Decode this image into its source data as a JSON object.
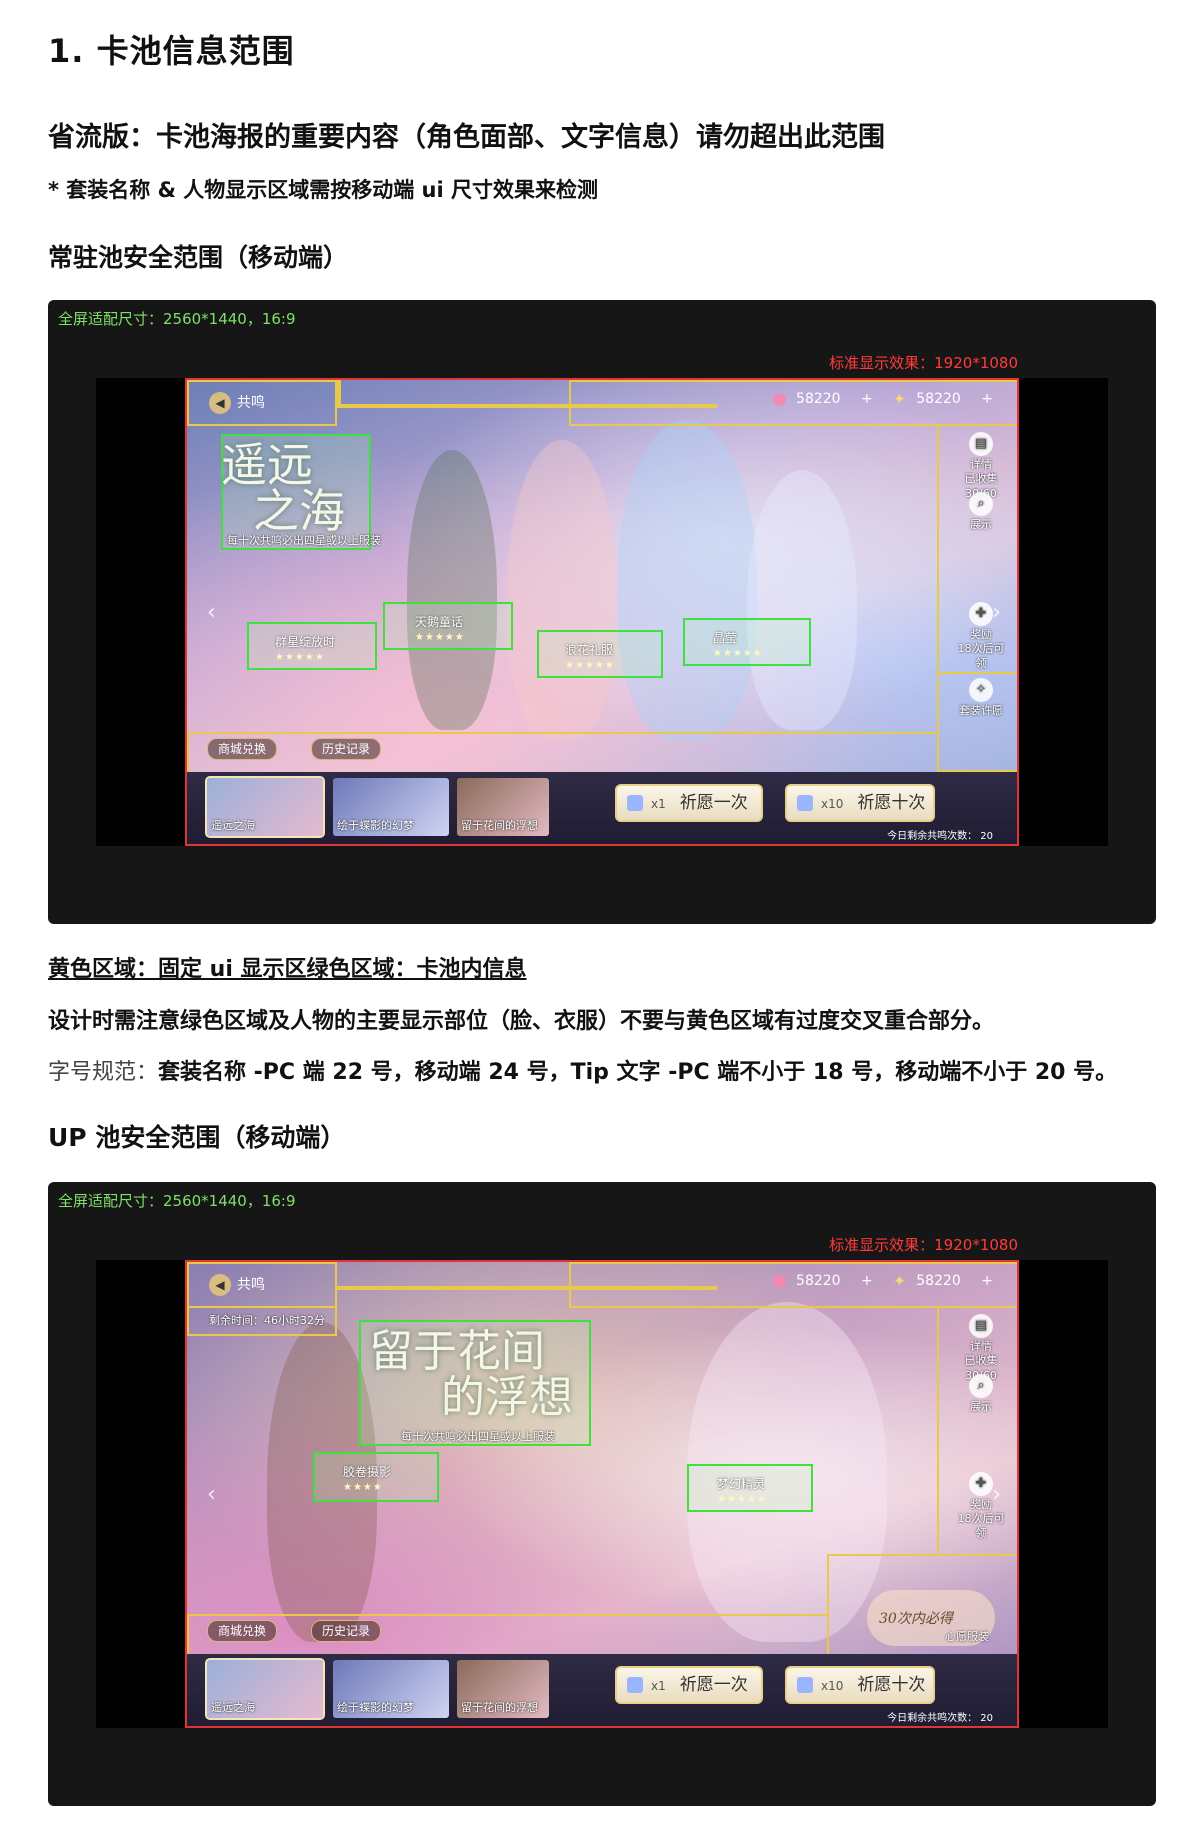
{
  "section_title": "1. 卡池信息范围",
  "subtitle": "省流版：卡池海报的重要内容（角色面部、文字信息）请勿超出此范围",
  "note": "* 套装名称 & 人物显示区域需按移动端 ui 尺寸效果来检测",
  "heading_standard": "常驻池安全范围（移动端）",
  "heading_up": "UP 池安全范围（移动端）",
  "legend": "黄色区域：固定 ui 显示区绿色区域：卡池内信息",
  "advice": "设计时需注意绿色区域及人物的主要显示部位（脸、衣服）不要与黄色区域有过度交叉重合部分。",
  "spec_label": "字号规范：",
  "spec_text": "套装名称 -PC 端 22 号，移动端 24 号，Tip 文字 -PC 端不小于 18 号，移动端不小于 20 号。",
  "colors": {
    "yellow_zone": "#e8c94a",
    "green_zone": "#40e040",
    "standard_frame": "#e03535",
    "fullscreen_label": "#7ee06a"
  },
  "screens": [
    {
      "fullscreen_label": "全屏适配尺寸：2560*1440，16:9",
      "standard_label": "标准显示效果：1920*1080",
      "back_label": "共鸣",
      "res1": "58220",
      "res2": "58220",
      "plus": "+",
      "pool_name_line1": "遥远",
      "pool_name_line2": "之海",
      "pool_tip": "每十次共鸣必出四星或以上服装",
      "outfits": [
        "群星绽放时",
        "天鹅童话",
        "浪花礼服",
        "晶莹"
      ],
      "stars": "★★★★★",
      "side_detail": "详情",
      "side_collected": "已收集30/60",
      "side_show": "展示",
      "side_reward": "奖励",
      "side_reward_sub": "18次后可领",
      "side_wish_outfit": "套装许愿",
      "btn_shop": "商城兑换",
      "btn_history": "历史记录",
      "thumbs": [
        "遥远之海",
        "绘于蝶影的幻梦",
        "留于花间的浮想"
      ],
      "wish1_count": "x1",
      "wish1_label": "祈愿一次",
      "wish10_count": "x10",
      "wish10_label": "祈愿十次",
      "remain": "今日剩余共鸣次数： 20",
      "icons": [
        "back-arrow-icon",
        "gem-icon",
        "star-currency-icon",
        "detail-icon",
        "search-icon",
        "gift-icon",
        "wish-icon",
        "chevron-left-icon",
        "chevron-right-icon",
        "crystal-icon"
      ]
    },
    {
      "fullscreen_label": "全屏适配尺寸：2560*1440，16:9",
      "standard_label": "标准显示效果：1920*1080",
      "back_label": "共鸣",
      "res1": "58220",
      "res2": "58220",
      "plus": "+",
      "timer": "剩余时间：46小时32分",
      "pool_name_line1": "留于花间",
      "pool_name_line2": "的浮想",
      "pool_tip": "每十次共鸣必出四星或以上服装",
      "outfits": [
        "胶卷摄影",
        "梦幻精灵"
      ],
      "stars4": "★★★★",
      "stars5": "★★★★★",
      "side_detail": "详情",
      "side_collected": "已收集30/60",
      "side_show": "展示",
      "side_reward": "奖励",
      "side_reward_sub": "18次后可领",
      "guarantee": "30次内必得",
      "guarantee_sub": "心愿服装",
      "btn_shop": "商城兑换",
      "btn_history": "历史记录",
      "thumbs": [
        "遥远之海",
        "绘于蝶影的幻梦",
        "留于花间的浮想"
      ],
      "wish1_count": "x1",
      "wish1_label": "祈愿一次",
      "wish10_count": "x10",
      "wish10_label": "祈愿十次",
      "remain": "今日剩余共鸣次数： 20"
    }
  ]
}
